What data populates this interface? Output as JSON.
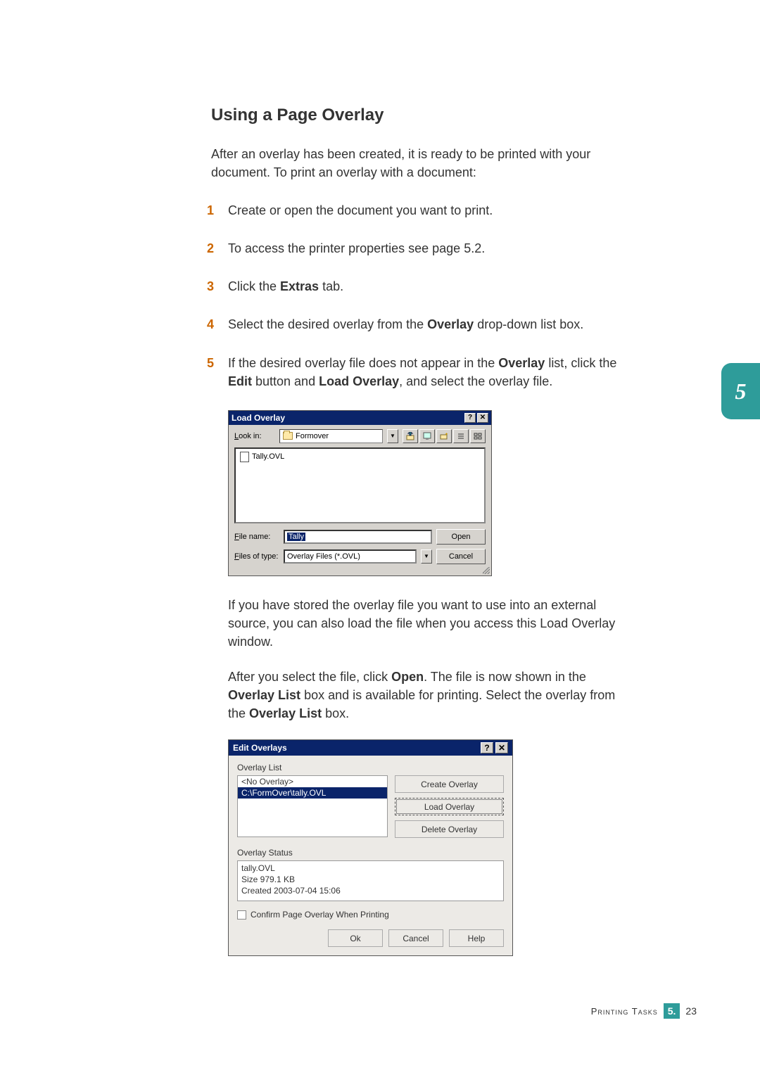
{
  "heading": "Using a Page Overlay",
  "intro": "After an overlay has been created, it is ready to be printed with your document. To print an overlay with a document:",
  "steps": {
    "s1": "Create or open the document you want to print.",
    "s2": "To access the printer properties see page 5.2.",
    "s3_a": "Click the ",
    "s3_b": "Extras",
    "s3_c": " tab.",
    "s4_a": "Select the desired overlay from the ",
    "s4_b": "Overlay",
    "s4_c": " drop-down list box.",
    "s5_a": "If the desired overlay file does not appear in the ",
    "s5_b": "Overlay",
    "s5_c": " list, click the ",
    "s5_d": "Edit",
    "s5_e": " button and ",
    "s5_f": "Load Overlay",
    "s5_g": ", and select the overlay file."
  },
  "nums": {
    "n1": "1",
    "n2": "2",
    "n3": "3",
    "n4": "4",
    "n5": "5"
  },
  "after1": "If you have stored the overlay file you want to use into an external source, you can also load the file when you access this Load Overlay window.",
  "after2_a": "After you select the file, click ",
  "after2_b": "Open",
  "after2_c": ". The file is now shown in the ",
  "after2_d": "Overlay List",
  "after2_e": " box and is available for printing. Select the overlay from the ",
  "after2_f": "Overlay List",
  "after2_g": " box.",
  "dlg1": {
    "title": "Load Overlay",
    "help": "?",
    "close": "✕",
    "lookin_lbl": "Look in:",
    "lookin_val": "Formover",
    "file_item": "Tally.OVL",
    "filename_lbl": "File name:",
    "filename_val": "Tally",
    "filetype_lbl": "Files of type:",
    "filetype_val": "Overlay Files (*.OVL)",
    "open": "Open",
    "cancel": "Cancel"
  },
  "dlg2": {
    "title": "Edit Overlays",
    "help": "?",
    "close": "✕",
    "list_lbl": "Overlay List",
    "li_none": "<No Overlay>",
    "li_path": "C:\\FormOver\\tally.OVL",
    "btn_create": "Create Overlay",
    "btn_load": "Load Overlay",
    "btn_delete": "Delete Overlay",
    "status_lbl": "Overlay Status",
    "status_1": "tally.OVL",
    "status_2": "Size 979.1 KB",
    "status_3": "Created 2003-07-04 15:06",
    "chk": "Confirm Page Overlay When Printing",
    "ok": "Ok",
    "cancel": "Cancel",
    "helpbtn": "Help"
  },
  "sidetab": "5",
  "footer": {
    "label": "Printing Tasks",
    "chapter": "5.",
    "page": "23"
  }
}
